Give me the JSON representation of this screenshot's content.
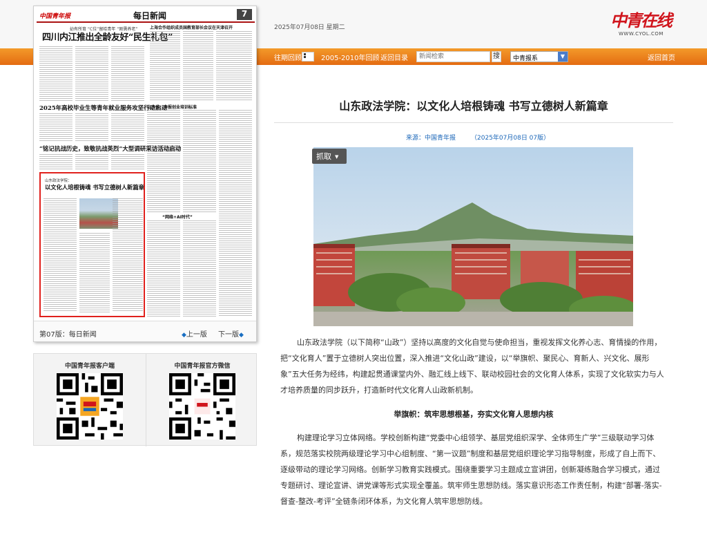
{
  "header": {
    "date": "2025年07月08日 星期二",
    "logo_text": "中青在线",
    "logo_url": "WWW.CYOL.COM"
  },
  "nav": {
    "past_review": "往期回顾",
    "years_review": "2005-2010年回顾",
    "back_to_index": "返回目录",
    "search_placeholder": "新闻检索",
    "search_button": "搜",
    "select_value": "中青报系",
    "home": "返回首页"
  },
  "paper": {
    "logo": "中国青年报",
    "section": "每日新闻",
    "page_number": "7",
    "sub_kicker": "幼有所育 “C位”留给青年 “刚需养老”",
    "headline": "四川内江推出全龄友好“民生礼包”",
    "head_right": "上海合作组织成员国教育部长会议在天津召开",
    "headline2": "2025年高校毕业生等青年就业服务攻坚行动启动",
    "head4": "山东省：申报创业培训标准",
    "headline3": "“铭记抗战历史，致敬抗战英烈”大型调研采访活动启动",
    "head6": "“网络+AI时代”",
    "highlight_kicker": "山东政法学院：",
    "highlight_title": "以文化人培根铸魂 书写立德树人新篇章",
    "footer_page": "第07版：每日新闻",
    "prev": "上一版",
    "next": "下一版"
  },
  "qr": {
    "left_title": "中国青年报客户端",
    "right_title": "中国青年报官方微信"
  },
  "article": {
    "title": "山东政法学院：以文化人培根铸魂 书写立德树人新篇章",
    "source": "来源：中国青年报",
    "source_date": "（2025年07月08日 07版）",
    "capture_label": "抓取",
    "para1": "山东政法学院（以下简称“山政”）坚持以高度的文化自觉与使命担当，重视发挥文化养心志、育情操的作用，把“文化育人”置于立德树人突出位置，深入推进“文化山政”建设，以“举旗帜、聚民心、育新人、兴文化、展形象”五大任务为经纬，构建起贯通课堂内外、融汇线上线下、联动校园社会的文化育人体系，实现了文化软实力与人才培养质量的同步跃升，打造新时代文化育人山政新机制。",
    "subhead": "举旗帜：筑牢思想根基，夯实文化育人思想内核",
    "para2": "构建理论学习立体网络。学校创新构建“党委中心组领学、基层党组织深学、全体师生广学”三级联动学习体系，规范落实校院两级理论学习中心组制度、“第一议题”制度和基层党组织理论学习指导制度，形成了自上而下、逐级带动的理论学习网络。创新学习教育实践模式。围绕重要学习主题成立宣讲团，创新凝练融合学习模式，通过专题研讨、理论宣讲、讲党课等形式实现全覆盖。筑牢师生思想防线。落实意识形态工作责任制，构建“部署-落实-督查-整改-考评”全链条闭环体系，为文化育人筑牢思想防线。"
  },
  "colors": {
    "nav_orange": "#e97a1c",
    "logo_red": "#d0141c",
    "source_blue": "#1a66b8",
    "highlight_border": "#e0201c"
  }
}
